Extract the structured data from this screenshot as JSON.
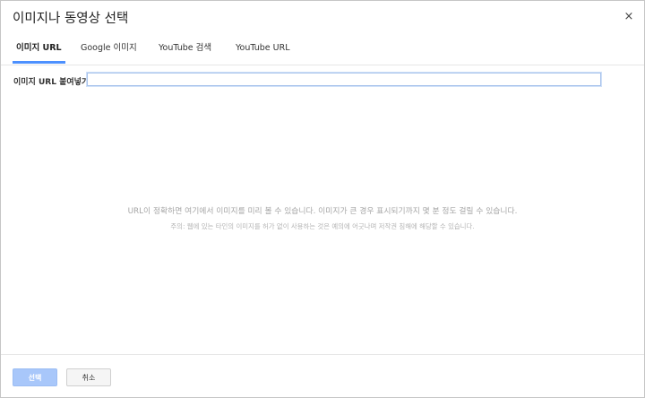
{
  "dialog": {
    "title": "이미지나 동영상 선택",
    "close_glyph": "×"
  },
  "tabs": [
    {
      "label": "이미지 URL",
      "active": true
    },
    {
      "label": "Google 이미지",
      "active": false
    },
    {
      "label": "YouTube 검색",
      "active": false
    },
    {
      "label": "YouTube URL",
      "active": false
    }
  ],
  "url_field": {
    "label": "이미지 URL 붙여넣기:",
    "value": "",
    "placeholder": ""
  },
  "notice": {
    "main": "URL이 정확하면 여기에서 이미지를 미리 볼 수 있습니다. 이미지가 큰 경우 표시되기까지 몇 분 정도 걸릴 수 있습니다.",
    "sub": "주의: 웹에 있는 타인의 이미지를 허가 없이 사용하는 것은 예의에 어긋나며 저작권 침해에 해당할 수 있습니다."
  },
  "footer": {
    "select_label": "선택",
    "cancel_label": "취소"
  },
  "colors": {
    "accent": "#4d90fe",
    "select_button_disabled": "#a8c7fa"
  }
}
